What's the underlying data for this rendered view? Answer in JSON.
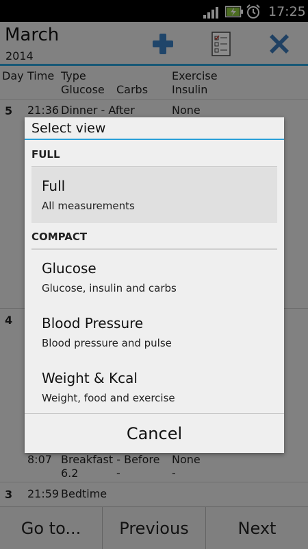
{
  "status_bar": {
    "time": "17:25",
    "icons": [
      "signal-icon",
      "battery-charging-icon",
      "alarm-clock-icon"
    ]
  },
  "header": {
    "month": "March",
    "year": "2014",
    "actions": [
      "add-icon",
      "checklist-icon",
      "close-icon"
    ]
  },
  "table": {
    "headers": {
      "day": "Day",
      "time": "Time",
      "type": "Type",
      "glucose": "Glucose",
      "carbs": "Carbs",
      "exercise": "Exercise",
      "insulin": "Insulin"
    },
    "rows": [
      {
        "day": "5",
        "time": "21:36",
        "type": "Dinner - After",
        "exercise": "None"
      },
      {
        "day": "4"
      },
      {
        "time": "8:07",
        "type": "Breakfast - Before",
        "glucose": "6.2",
        "carbs": "-",
        "exercise": "None",
        "insulin": "-"
      },
      {
        "day": "3",
        "time": "21:59",
        "type": "Bedtime"
      }
    ]
  },
  "bottom_bar": {
    "goto": "Go to...",
    "previous": "Previous",
    "next": "Next"
  },
  "dialog": {
    "title": "Select view",
    "sections": [
      {
        "header": "FULL",
        "items": [
          {
            "title": "Full",
            "subtitle": "All measurements",
            "selected": true
          }
        ]
      },
      {
        "header": "COMPACT",
        "items": [
          {
            "title": "Glucose",
            "subtitle": "Glucose, insulin and carbs"
          },
          {
            "title": "Blood Pressure",
            "subtitle": "Blood pressure and pulse"
          },
          {
            "title": "Weight & Kcal",
            "subtitle": "Weight, food and exercise"
          }
        ]
      }
    ],
    "cancel": "Cancel"
  },
  "colors": {
    "accent": "#2aa0d8",
    "add_icon": "#3a7fc1",
    "close_icon": "#3b77b5"
  }
}
